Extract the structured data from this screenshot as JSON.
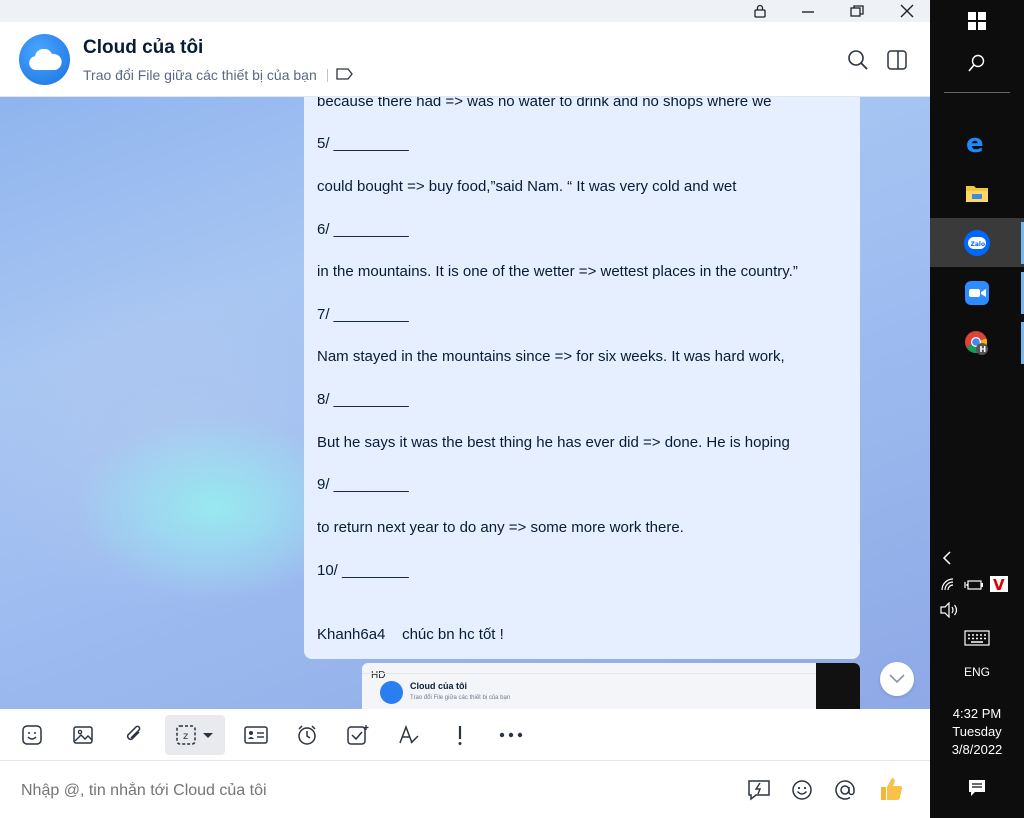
{
  "header": {
    "title": "Cloud của tôi",
    "subtitle": "Trao đổi File giữa các thiết bị của bạn"
  },
  "message": {
    "lines": [
      "because there had => was no water to drink and no shops where we",
      "5/ _________",
      "could bought => buy food,”said Nam. “ It was very cold and wet",
      "6/ _________",
      "in the mountains. It is one of the wetter => wettest places in the country.”",
      "7/ _________",
      "Nam stayed in the mountains since => for six weeks. It was hard work,",
      "8/ _________",
      "But he says it was the best thing he has ever did => done. He is hoping",
      "9/ _________",
      "to return next year to do any => some more work there.",
      "10/ ________",
      "Khanh6a4    chúc bn hc tốt !"
    ]
  },
  "thumbnail": {
    "badge": "HD",
    "title": "Cloud của tôi",
    "subtitle": "Trao đổi File giữa các thiết bị của bạn"
  },
  "composer": {
    "placeholder": "Nhập @, tin nhắn tới Cloud của tôi"
  },
  "taskbar": {
    "language": "ENG",
    "time": "4:32 PM",
    "day": "Tuesday",
    "date": "3/8/2022"
  },
  "colors": {
    "accent": "#0068ff",
    "bubble": "#e5efff",
    "text": "#081c36",
    "taskbar": "#0d0d0d"
  }
}
